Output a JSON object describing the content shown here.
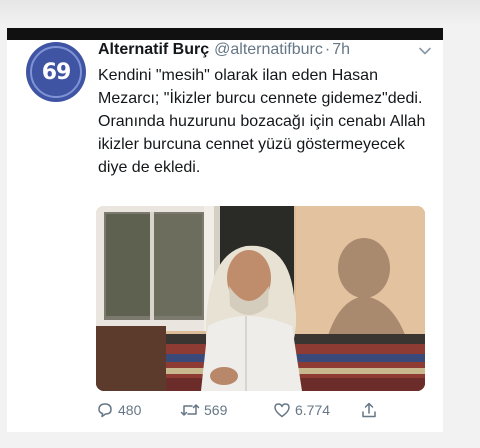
{
  "tweet": {
    "author_name": "Alternatif Burç",
    "handle": "@alternatifburc",
    "separator": "·",
    "time": "7h",
    "avatar_text": "69",
    "text": "Kendini \"mesih\" olarak ilan eden Hasan Mezarcı; \"İkizler burcu cennete gidemez\"dedi. Oranında huzurunu bozacağı için cenabı Allah ikizler burcuna cennet yüzü göstermeyecek diye de ekledi.",
    "replies": "480",
    "retweets": "569",
    "likes": "6.774"
  },
  "icons": {
    "reply": "reply-icon",
    "retweet": "retweet-icon",
    "like": "heart-icon",
    "share": "share-icon",
    "menu": "chevron-down-icon"
  },
  "colors": {
    "accent_avatar": "#3f55a3",
    "text_primary": "#14171a",
    "text_secondary": "#657786"
  }
}
